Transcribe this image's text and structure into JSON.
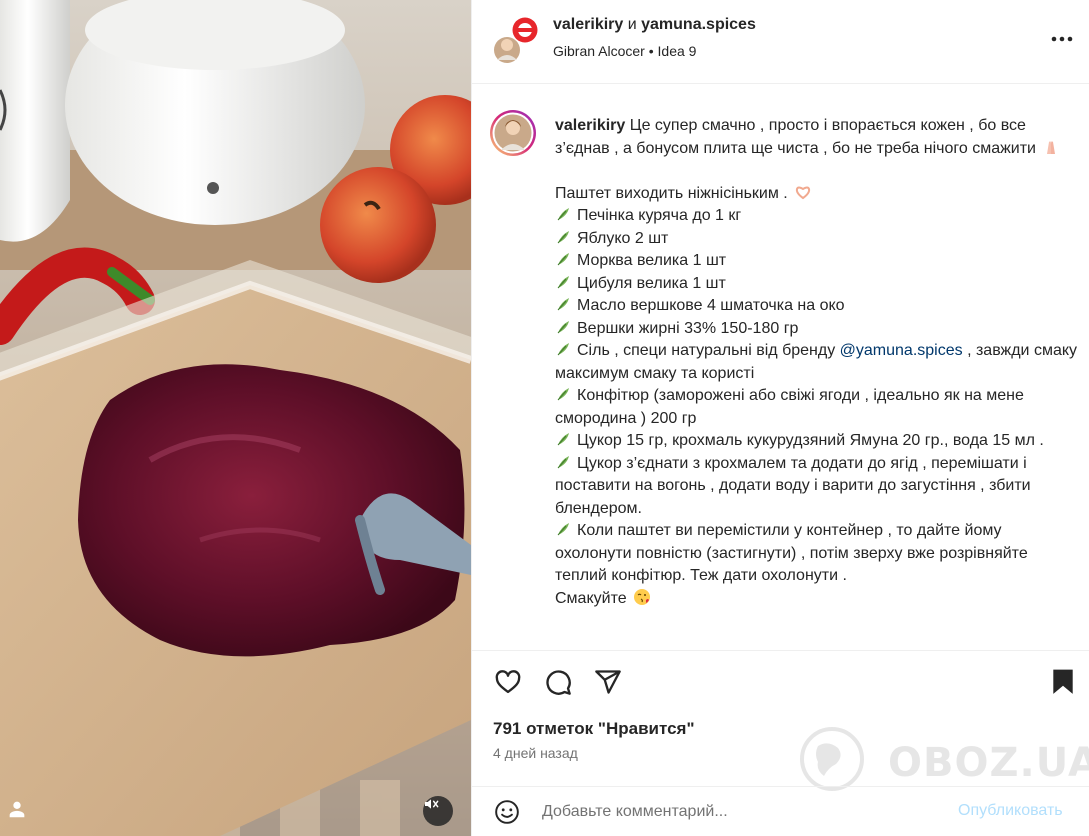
{
  "media": {
    "description_icon": "tag-icon",
    "mute_icon": "muted-speaker-icon"
  },
  "header": {
    "user1": "valerikiry",
    "joiner": "и",
    "user2": "yamuna.spices",
    "audio": "Gibran Alcocer",
    "separator": "•",
    "track": "Idea 9",
    "more_icon": "more-horizontal-icon"
  },
  "caption": {
    "username": "valerikiry",
    "intro": "Це супер смачно , просто і впорається кожен , бо все з’єднав , а бонусом плита ще чиста , бо не треба нічого смажити",
    "intro_emoji": "praying-hands-emoji",
    "pate_line": "Паштет виходить ніжнісіньким .",
    "pate_emoji": "heart-hands-emoji",
    "items": [
      "Печінка куряча до 1 кг",
      "Яблуко 2 шт",
      "Морква велика 1 шт",
      "Цибуля велика 1 шт",
      "Масло вершкове 4 шматочка на око",
      "Вершки жирні 33% 150-180 гр"
    ],
    "salt_before": "Сіль , специ натуральні від бренду ",
    "mention": "@yamuna.spices",
    "salt_after": " , завжди смаку максимум смаку та користі",
    "confiture": "Конфітюр (заморожені або свіжі ягоди , ідеально як на мене смородина ) 200 гр",
    "sugar": "Цукор 15 гр, крохмаль кукурудзяний Ямуна 20 гр., вода 15 мл .",
    "step1": "Цукор з’єднати з крохмалем та додати до ягід , перемішати і поставити на вогонь , додати воду і варити до загустіння , збити блендером.",
    "step2": "Коли паштет ви перемістили у контейнер , то дайте йому охолонути повністю (застигнути) , потім зверху вже розрівняйте теплий конфітюр. Теж дати охолонути .",
    "outro": "Смакуйте",
    "outro_emoji": "kissing-face-emoji",
    "bullet_icon": "herb-icon"
  },
  "actions": {
    "like_icon": "heart-icon",
    "comment_icon": "comment-icon",
    "share_icon": "send-icon",
    "save_icon": "bookmark-icon"
  },
  "likes": "791 отметок \"Нравится\"",
  "time": "4 дней назад",
  "comment": {
    "placeholder": "Добавьте комментарий...",
    "publish": "Опубликовать",
    "emoji_icon": "smiley-icon"
  },
  "watermark": {
    "text": "OBOZ.UA",
    "logo_icon": "globe-logo"
  },
  "colors": {
    "text": "#262626",
    "muted": "#737373",
    "link": "#00376b",
    "publish_disabled": "#b2dffc",
    "divider": "#efefef"
  }
}
